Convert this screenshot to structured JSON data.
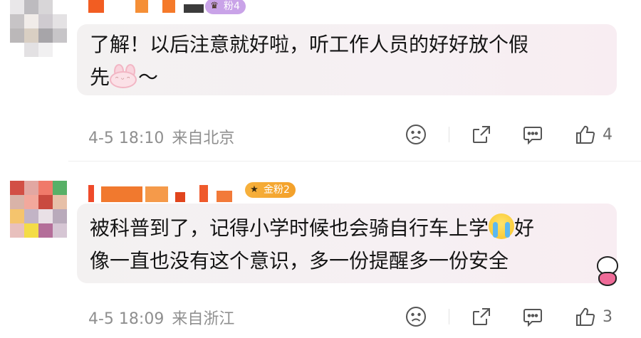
{
  "comments": [
    {
      "badge": "粉4",
      "text_line1": "了解！以后注意就好啦，听工作人员的好好放个假",
      "text_line2": "先",
      "time": "4-5 18:10",
      "location": "来自北京",
      "like_count": "4",
      "emoji": "bunny-face-emoji"
    },
    {
      "badge": "金粉2",
      "text_part1": "被科普到了，记得小学时候也会骑自行车上学",
      "text_part2": "好",
      "text_line2": "像一直也没有这个意识，多一份提醒多一份安全",
      "time": "4-5 18:09",
      "location": "来自浙江",
      "like_count": "3",
      "emoji": "loudly-crying-face-emoji"
    }
  ],
  "icons": {
    "dislike": "sad-face-icon",
    "share": "share-icon",
    "reply": "comment-bubble-icon",
    "like": "thumbs-up-icon"
  },
  "colors": {
    "badge_purple": "#c9a3e8",
    "badge_gold": "#f3a02a",
    "meta_gray": "#8f8f8f"
  }
}
